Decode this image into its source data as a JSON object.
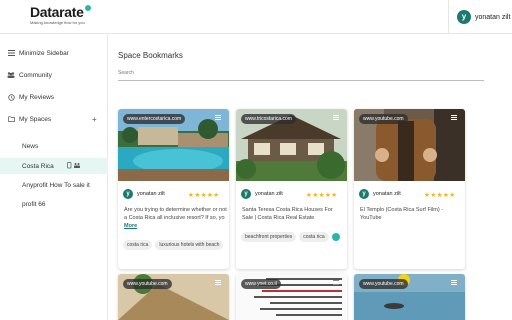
{
  "header": {
    "logo_text": "Datarate",
    "logo_tagline": "Making knowledge flow for you",
    "user_initial": "y",
    "user_name": "yonatan zilt"
  },
  "sidebar": {
    "items": [
      {
        "label": "Minimize Sidebar",
        "icon": "menu-icon"
      },
      {
        "label": "Community",
        "icon": "community-icon"
      },
      {
        "label": "My Reviews",
        "icon": "history-icon"
      },
      {
        "label": "My Spaces",
        "icon": "folder-icon"
      }
    ],
    "spaces": [
      {
        "label": "News"
      },
      {
        "label": "Costa Rica"
      },
      {
        "label": "Anyprofit How To sale it"
      },
      {
        "label": "profit 66"
      }
    ]
  },
  "main": {
    "title": "Space Bookmarks",
    "search_label": "Search"
  },
  "cards": [
    {
      "url": "www.entercostarica.com",
      "user_initial": "y",
      "user": "yonatan zilt",
      "stars": "★★★★★",
      "text": "Are you trying to determine whether or not a Costa Rica all inclusive resort? If so, yo",
      "more": "More",
      "tags": [
        "costa rica",
        "luxurious hotels with beach"
      ]
    },
    {
      "url": "www.tricostarica.com",
      "user_initial": "y",
      "user": "yonatan zilt",
      "stars": "★★★★★",
      "text": "Santa Teresa Costa Rica Houses For Sale | Costa Rica Real Estate",
      "tags": [
        "beachfront properties",
        "costa rica"
      ]
    },
    {
      "url": "www.youtube.com",
      "user_initial": "y",
      "user": "yonatan zilt",
      "stars": "★★★★★",
      "text": "El Templo (Costa Rica Surf Film) - YouTube",
      "tags": []
    },
    {
      "url": "www.youtube.com"
    },
    {
      "url": "www.ynet.co.il"
    },
    {
      "url": "www.youtube.com"
    }
  ],
  "colors": {
    "accent": "#1a7a6c",
    "active_bg": "#e6f6f3",
    "star": "#f3b21a"
  }
}
